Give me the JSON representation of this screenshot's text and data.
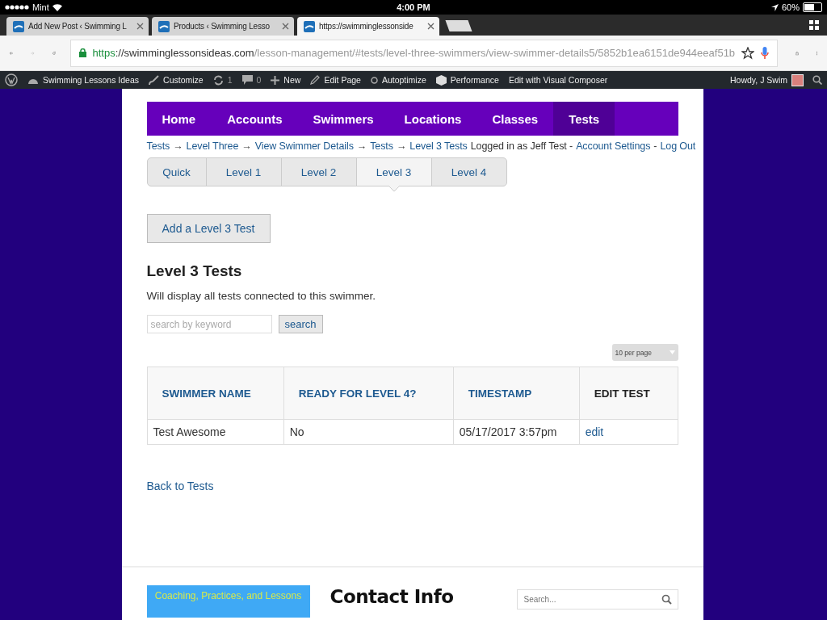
{
  "status_bar": {
    "carrier": "Mint",
    "time": "4:00 PM",
    "battery": "60%"
  },
  "browser_tabs": [
    {
      "title": "Add New Post ‹ Swimming L",
      "selected": false
    },
    {
      "title": "Products ‹ Swimming Lesso",
      "selected": false
    },
    {
      "title": "https://swimminglessonside",
      "selected": true
    }
  ],
  "address_bar": {
    "scheme": "https",
    "host": "://swimminglessonsideas.com",
    "path": "/lesson-management/#tests/level-three-swimmers/view-swimmer-details5/5852b1ea6151de944eeaf51b"
  },
  "admin_bar": {
    "items": [
      {
        "kind": "site",
        "label": "Swimming Lessons Ideas"
      },
      {
        "kind": "brush",
        "label": "Customize"
      },
      {
        "kind": "updates",
        "label": "1"
      },
      {
        "kind": "comments",
        "label": "0"
      },
      {
        "kind": "new",
        "label": "New"
      },
      {
        "kind": "pencil",
        "label": "Edit Page"
      },
      {
        "kind": "circle",
        "label": "Autoptimize"
      },
      {
        "kind": "cube",
        "label": "Performance"
      },
      {
        "kind": "plain",
        "label": "Edit with Visual Composer"
      }
    ],
    "user": "Howdy, J Swim"
  },
  "nav": [
    {
      "label": "Home",
      "selected": false
    },
    {
      "label": "Accounts",
      "selected": false
    },
    {
      "label": "Swimmers",
      "selected": false
    },
    {
      "label": "Locations",
      "selected": false
    },
    {
      "label": "Classes",
      "selected": false
    },
    {
      "label": "Tests",
      "selected": true
    }
  ],
  "breadcrumbs": [
    "Tests",
    "Level Three",
    "View Swimmer Details",
    "Tests",
    "Level 3 Tests"
  ],
  "breadcrumb_separator": "→",
  "login": {
    "text": "Logged in as Jeff Test -",
    "account_link": "Account Settings",
    "dash": "-",
    "logout_link": "Log Out"
  },
  "level_tabs": [
    {
      "label": "Quick",
      "selected": false
    },
    {
      "label": "Level 1",
      "selected": false
    },
    {
      "label": "Level 2",
      "selected": false
    },
    {
      "label": "Level 3",
      "selected": true
    },
    {
      "label": "Level 4",
      "selected": false
    }
  ],
  "add_button": "Add a Level 3 Test",
  "heading": "Level 3 Tests",
  "description": "Will display all tests connected to this swimmer.",
  "search": {
    "placeholder": "search by keyword",
    "button": "search"
  },
  "per_page": "10 per page",
  "table": {
    "columns": [
      {
        "label": "SWIMMER NAME",
        "sortable": true
      },
      {
        "label": "READY FOR LEVEL 4?",
        "sortable": true
      },
      {
        "label": "TIMESTAMP",
        "sortable": true
      },
      {
        "label": "EDIT TEST",
        "sortable": false
      }
    ],
    "rows": [
      {
        "swimmer_name": "Test Awesome",
        "ready": "No",
        "timestamp": "05/17/2017 3:57pm",
        "edit": "edit"
      }
    ]
  },
  "back_link": "Back to Tests",
  "footer": {
    "banner_tagline": "Coaching, Practices, and Lessons",
    "contact_heading": "Contact Info",
    "search_placeholder": "Search..."
  }
}
